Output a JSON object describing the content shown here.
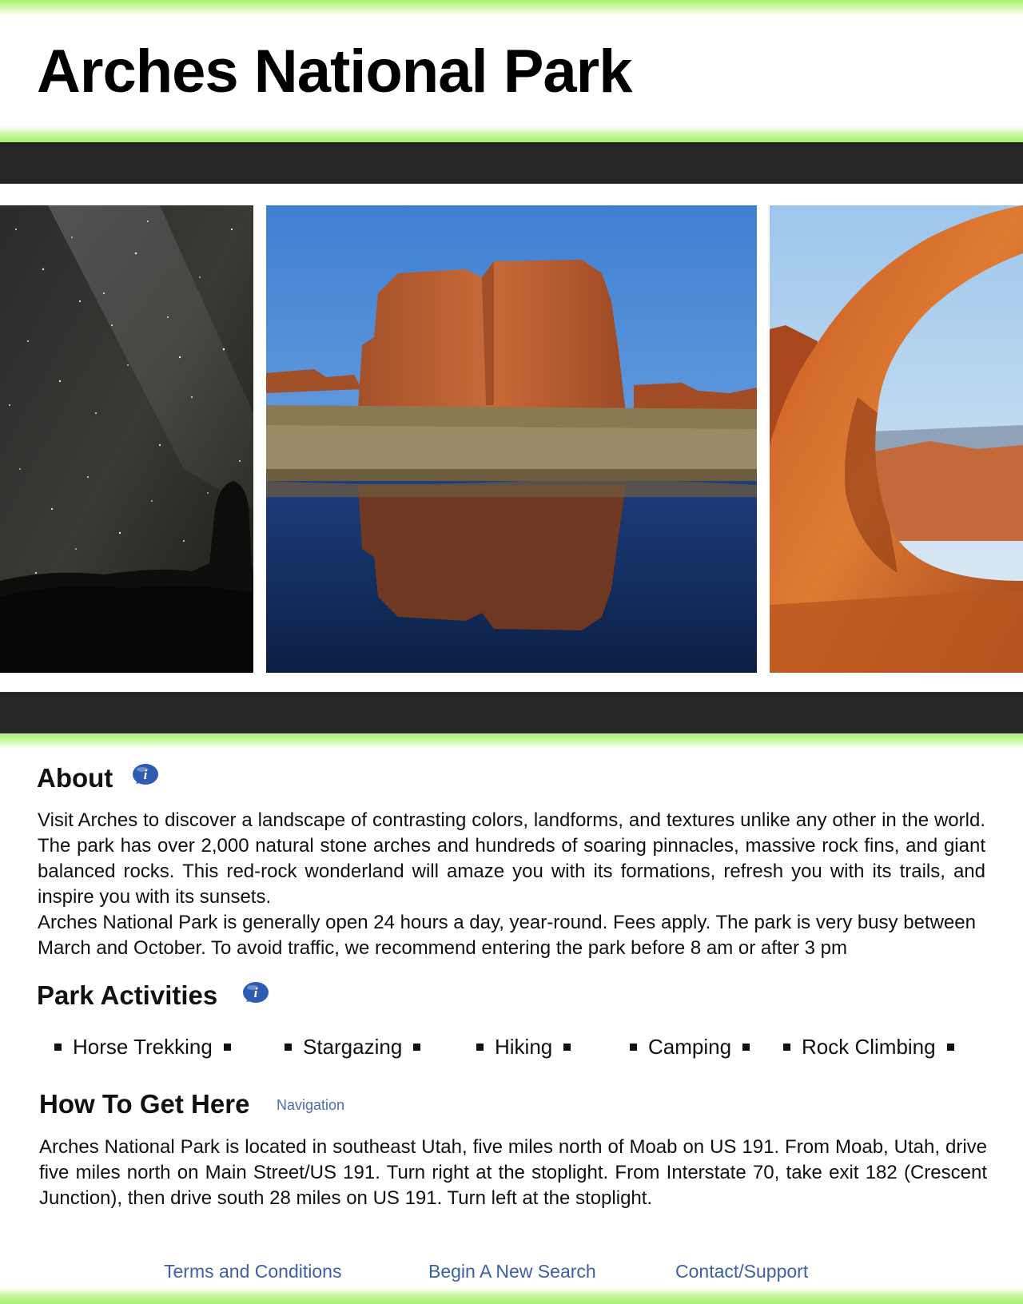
{
  "header": {
    "title": "Arches National Park"
  },
  "gallery": [
    {
      "subject": "milky-way-night-sky"
    },
    {
      "subject": "courthouse-towers-reflection"
    },
    {
      "subject": "double-o-arch"
    }
  ],
  "about": {
    "heading": "About",
    "icon": "info-icon",
    "paragraph_1": "Visit Arches to discover a landscape of contrasting colors, landforms, and textures unlike any other in the world. The park has over 2,000 natural stone arches and hundreds of soaring pinnacles, massive rock fins, and giant balanced rocks. This red-rock wonderland will amaze you with its formations, refresh you with its trails, and inspire you with its sunsets.",
    "paragraph_2": "Arches National Park is generally open 24 hours a day, year-round. Fees apply. The park is very busy between March and October. To avoid traffic, we recommend entering the park before 8 am or after 3 pm"
  },
  "activities": {
    "heading": "Park Activities",
    "icon": "info-icon",
    "items": [
      "Horse Trekking",
      "Stargazing",
      "Hiking",
      "Camping",
      "Rock Climbing"
    ]
  },
  "directions": {
    "heading": "How To Get Here",
    "nav_link": "Navigation",
    "text": "Arches National Park is located in southeast Utah, five miles north of Moab on US 191. From Moab, Utah, drive five miles north on Main Street/US 191. Turn right at the stoplight. From Interstate 70, take exit 182 (Crescent Junction), then drive south 28 miles on US 191. Turn left at the stoplight."
  },
  "footer": {
    "links": [
      "Terms and Conditions",
      "Begin A New Search",
      "Contact/Support"
    ]
  },
  "colors": {
    "accent_green": "#a6f26c",
    "dark_bar": "#262626",
    "link_blue": "#3d5fa8",
    "icon_blue": "#2f5cb3"
  }
}
